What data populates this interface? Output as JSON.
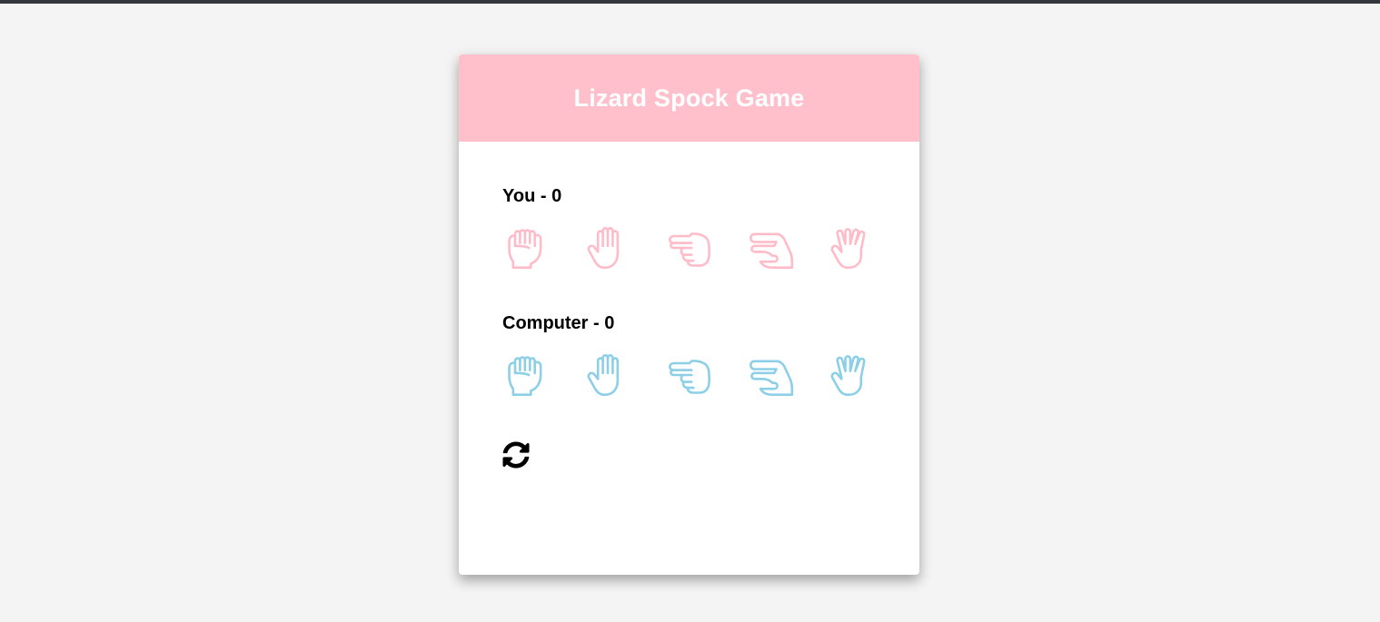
{
  "game": {
    "title": "Lizard Spock Game"
  },
  "player": {
    "label": "You - 0",
    "color": "#ffbcc8",
    "choices": [
      "rock-icon",
      "paper-icon",
      "scissors-icon",
      "lizard-icon",
      "spock-icon"
    ]
  },
  "computer": {
    "label": "Computer - 0",
    "color": "#8ccfe7",
    "choices": [
      "rock-icon",
      "paper-icon",
      "scissors-icon",
      "lizard-icon",
      "spock-icon"
    ]
  },
  "controls": {
    "reset_icon": "refresh-icon"
  },
  "colors": {
    "header": "#ffc0cb",
    "background": "#f4f4f4"
  }
}
